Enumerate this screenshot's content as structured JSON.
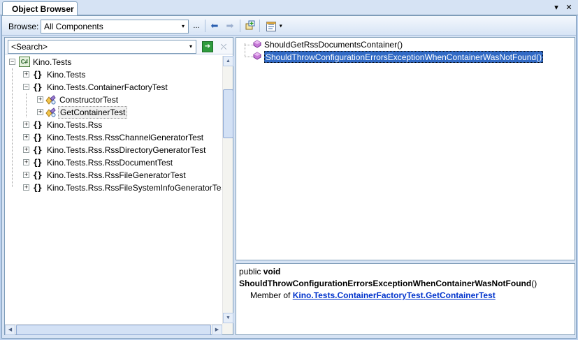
{
  "window": {
    "tab_title": "Object Browser",
    "dropdown_glyph": "▾",
    "close_glyph": "✕"
  },
  "toolbar": {
    "browse_label": "Browse:",
    "browse_value": "All Components",
    "ellipsis": "...",
    "back_glyph": "⬅",
    "forward_glyph": "➡"
  },
  "search": {
    "value": "<Search>",
    "go_glyph": "➔",
    "clear_glyph": "⛌"
  },
  "tree": {
    "root": "Kino.Tests",
    "namespace_glyph": "{}",
    "expand_glyph": "+",
    "collapse_glyph": "−",
    "items": [
      {
        "label": "Kino.Tests",
        "kind": "namespace",
        "expanded": false
      },
      {
        "label": "Kino.Tests.ContainerFactoryTest",
        "kind": "namespace",
        "expanded": true
      },
      {
        "label": "ConstructorTest",
        "kind": "class",
        "expanded": false
      },
      {
        "label": "GetContainerTest",
        "kind": "class",
        "expanded": false,
        "selected": true
      },
      {
        "label": "Kino.Tests.Rss",
        "kind": "namespace",
        "expanded": false
      },
      {
        "label": "Kino.Tests.Rss.RssChannelGeneratorTest",
        "kind": "namespace",
        "expanded": false
      },
      {
        "label": "Kino.Tests.Rss.RssDirectoryGeneratorTest",
        "kind": "namespace",
        "expanded": false
      },
      {
        "label": "Kino.Tests.Rss.RssDocumentTest",
        "kind": "namespace",
        "expanded": false
      },
      {
        "label": "Kino.Tests.Rss.RssFileGeneratorTest",
        "kind": "namespace",
        "expanded": false
      },
      {
        "label": "Kino.Tests.Rss.RssFileSystemInfoGeneratorTest",
        "kind": "namespace",
        "expanded": false
      }
    ]
  },
  "members": [
    {
      "label": "ShouldGetRssDocumentsContainer()",
      "selected": false
    },
    {
      "label": "ShouldThrowConfigurationErrorsExceptionWhenContainerWasNotFound()",
      "selected": true
    }
  ],
  "description": {
    "modifier": "public",
    "return_type": "void",
    "method_name": "ShouldThrowConfigurationErrorsExceptionWhenContainerWasNotFound",
    "parens": "()",
    "member_of_label": "Member of",
    "namespace_link": "Kino.Tests.ContainerFactoryTest",
    "separator": ".",
    "class_link": "GetContainerTest"
  },
  "colors": {
    "selection": "#316ac5",
    "link": "#0033cc",
    "chrome": "#d6e3f4",
    "border": "#7f9db9"
  }
}
